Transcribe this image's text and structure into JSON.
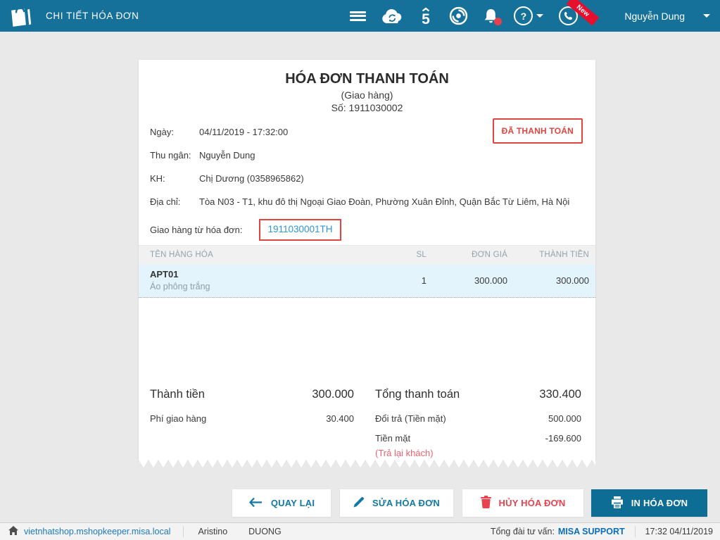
{
  "topbar": {
    "title": "CHI TIẾT HÓA ĐƠN",
    "user_name": "Nguyễn Dung",
    "new_badge": "New",
    "icons": {
      "help_glyph": "?",
      "sme5_glyph": "5"
    }
  },
  "invoice": {
    "title": "HÓA ĐƠN THANH TOÁN",
    "type": "(Giao hàng)",
    "number": "Số: 1911030002",
    "paid_stamp": "ĐÃ THANH TOÁN",
    "fields": [
      {
        "label": "Ngày:",
        "value": "04/11/2019 - 17:32:00"
      },
      {
        "label": "Thu ngân:",
        "value": "Nguyễn Dung"
      },
      {
        "label": "KH:",
        "value": "Chị Dương (0358965862)"
      },
      {
        "label": "Địa chỉ:",
        "value": "Tòa N03 - T1, khu đô thị Ngoại Giao Đoàn, Phường Xuân Đỉnh, Quận Bắc Từ Liêm, Hà Nội"
      }
    ],
    "delivery_source_label": "Giao hàng từ hóa đơn:",
    "delivery_source_link": "1911030001TH"
  },
  "items": {
    "headers": {
      "name": "TÊN HÀNG HÓA",
      "qty": "SL",
      "unit_price": "ĐƠN GIÁ",
      "amount": "THÀNH TIỀN"
    },
    "rows": [
      {
        "code": "APT01",
        "name": "Áo phông trắng",
        "qty": "1",
        "unit_price": "300.000",
        "amount": "300.000"
      }
    ]
  },
  "totals": {
    "subtotal_label": "Thành tiền",
    "subtotal_value": "300.000",
    "shipping_label": "Phí giao hàng",
    "shipping_value": "30.400",
    "grand_total_label": "Tổng thanh toán",
    "grand_total_value": "330.400",
    "exchange_label": "Đổi trả (Tiền mặt)",
    "exchange_value": "500.000",
    "cash_label": "Tiền mặt",
    "cash_value": "-169.600",
    "cash_note": "(Trả lại khách)"
  },
  "actions": {
    "back": "QUAY LẠI",
    "edit": "SỬA HÓA ĐƠN",
    "cancel": "HỦY HÓA ĐƠN",
    "print": "IN HÓA ĐƠN"
  },
  "footer": {
    "site_url": "vietnhatshop.mshopkeeper.misa.local",
    "brand": "Aristino",
    "branch": "DUONG",
    "support_label": "Tổng đài tư vấn:",
    "support_link": "MISA SUPPORT",
    "datetime": "17:32 04/11/2019"
  },
  "colors": {
    "topbar": "#15719a",
    "accent": "#1278a5",
    "danger": "#e2443f",
    "link": "#2e97cf",
    "print_button": "#0d6d94",
    "highlight_row": "#e4f4fc"
  }
}
